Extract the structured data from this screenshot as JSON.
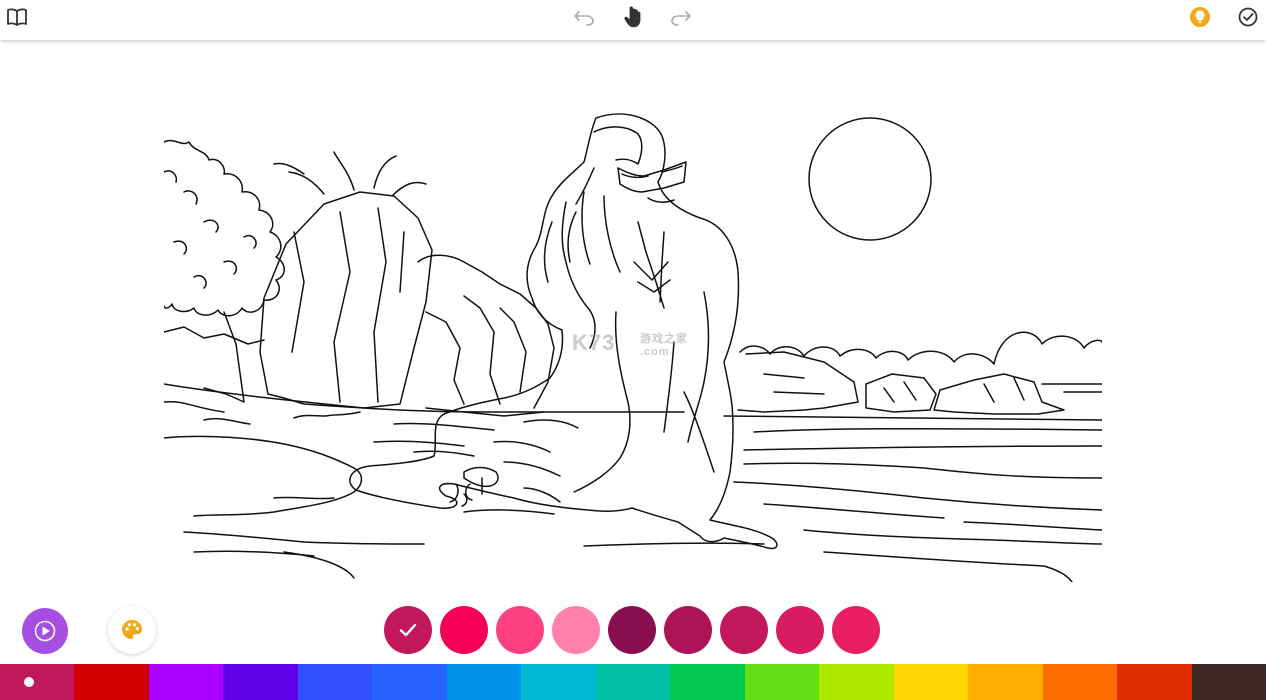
{
  "toolbar": {
    "icons": {
      "left": "book-icon",
      "undo": "undo-icon",
      "hand": "hand-icon",
      "redo": "redo-icon",
      "hint": "lightbulb-icon",
      "done": "check-circle-icon"
    },
    "hint_color": "#f2a81d"
  },
  "artwork": {
    "watermark": "K73",
    "watermark_sub": "游戏之家",
    "watermark_domain": ".com"
  },
  "controls": {
    "play_color": "#a64ee0",
    "play_icon": "play-icon",
    "palette_icon": "palette-icon"
  },
  "shade_swatches": [
    {
      "color": "#c2185b",
      "selected": true
    },
    {
      "color": "#f50057",
      "selected": false
    },
    {
      "color": "#ff4081",
      "selected": false
    },
    {
      "color": "#ff80ab",
      "selected": false
    },
    {
      "color": "#880e4f",
      "selected": false
    },
    {
      "color": "#ad1457",
      "selected": false
    },
    {
      "color": "#c2185b",
      "selected": false
    },
    {
      "color": "#d81b60",
      "selected": false
    },
    {
      "color": "#e91e63",
      "selected": false
    }
  ],
  "color_bar": [
    {
      "color": "#c2185b",
      "active": true
    },
    {
      "color": "#d50000",
      "active": false
    },
    {
      "color": "#aa00ff",
      "active": false
    },
    {
      "color": "#6200ea",
      "active": false
    },
    {
      "color": "#304ffe",
      "active": false
    },
    {
      "color": "#2962ff",
      "active": false
    },
    {
      "color": "#0091ea",
      "active": false
    },
    {
      "color": "#00b8d4",
      "active": false
    },
    {
      "color": "#00bfa5",
      "active": false
    },
    {
      "color": "#00c853",
      "active": false
    },
    {
      "color": "#64dd17",
      "active": false
    },
    {
      "color": "#aeea00",
      "active": false
    },
    {
      "color": "#ffd600",
      "active": false
    },
    {
      "color": "#ffab00",
      "active": false
    },
    {
      "color": "#ff6d00",
      "active": false
    },
    {
      "color": "#dd2c00",
      "active": false
    },
    {
      "color": "#3e2723",
      "active": false
    }
  ]
}
